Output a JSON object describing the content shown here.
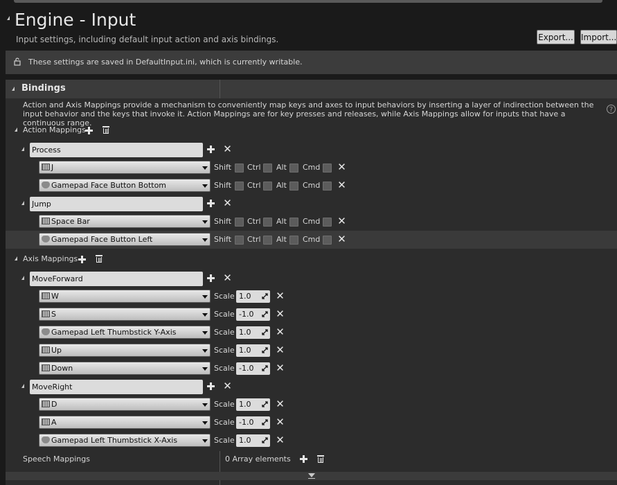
{
  "header": {
    "title": "Engine - Input",
    "subtitle": "Input settings, including default input action and axis bindings.",
    "export_label": "Export...",
    "import_label": "Import..."
  },
  "notice": {
    "text": "These settings are saved in DefaultInput.ini, which is currently writable."
  },
  "bindings": {
    "title": "Bindings",
    "description": "Action and Axis Mappings provide a mechanism to conveniently map keys and axes to input behaviors by inserting a layer of indirection between the input behavior and the keys that invoke it. Action Mappings are for key presses and releases, while Axis Mappings allow for inputs that have a continuous range.",
    "action_label": "Action Mappings",
    "axis_label": "Axis Mappings",
    "speech_label": "Speech Mappings",
    "speech_count": "0 Array elements",
    "modifiers": [
      "Shift",
      "Ctrl",
      "Alt",
      "Cmd"
    ],
    "scale_label": "Scale",
    "actions": [
      {
        "name": "Process",
        "keys": [
          {
            "key": "J",
            "icon": "keyboard-icon"
          },
          {
            "key": "Gamepad Face Button Bottom",
            "icon": "gamepad-icon"
          }
        ]
      },
      {
        "name": "Jump",
        "keys": [
          {
            "key": "Space Bar",
            "icon": "keyboard-icon"
          },
          {
            "key": "Gamepad Face Button Left",
            "icon": "gamepad-icon"
          }
        ]
      }
    ],
    "axes": [
      {
        "name": "MoveForward",
        "keys": [
          {
            "key": "W",
            "scale": "1.0",
            "icon": "keyboard-icon"
          },
          {
            "key": "S",
            "scale": "-1.0",
            "icon": "keyboard-icon"
          },
          {
            "key": "Gamepad Left Thumbstick Y-Axis",
            "scale": "1.0",
            "icon": "gamepad-icon"
          },
          {
            "key": "Up",
            "scale": "1.0",
            "icon": "keyboard-icon"
          },
          {
            "key": "Down",
            "scale": "-1.0",
            "icon": "keyboard-icon"
          }
        ]
      },
      {
        "name": "MoveRight",
        "keys": [
          {
            "key": "D",
            "scale": "1.0",
            "icon": "keyboard-icon"
          },
          {
            "key": "A",
            "scale": "-1.0",
            "icon": "keyboard-icon"
          },
          {
            "key": "Gamepad Left Thumbstick X-Axis",
            "scale": "1.0",
            "icon": "gamepad-icon"
          }
        ]
      }
    ]
  }
}
